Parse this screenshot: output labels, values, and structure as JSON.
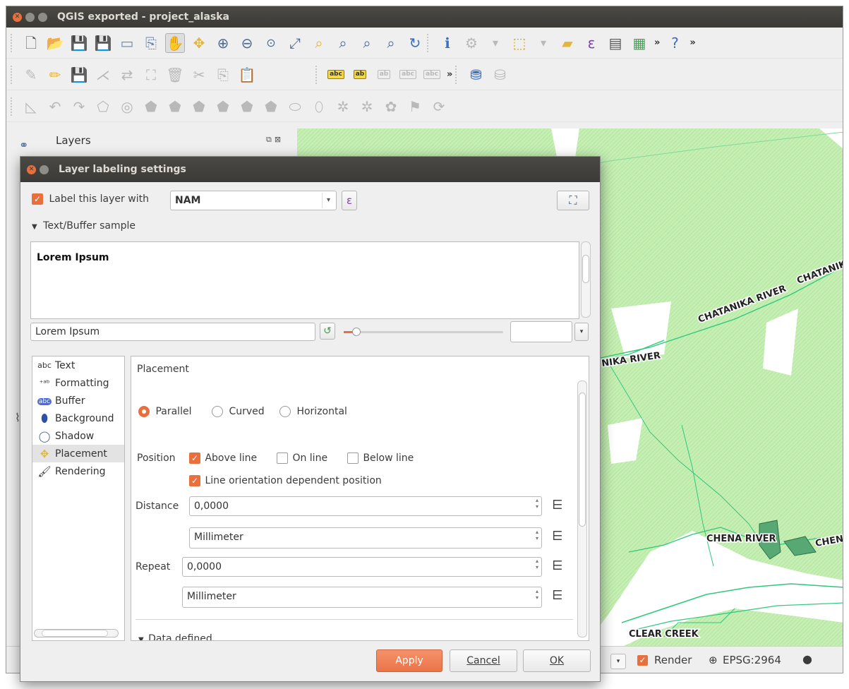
{
  "window": {
    "title": "QGIS exported - project_alaska"
  },
  "toolbar_overflow": "»",
  "layers_panel": {
    "title": "Layers"
  },
  "map_labels": {
    "chatanika_1": "CHATANIKA RIVER",
    "chatanika_2": "CHATANIKA RIVER",
    "chatanika_3": "NIKA RIVER",
    "chatanika_4": "CHATANIKA",
    "chena_1": "CHENA RIVER",
    "chena_2": "CHENA",
    "clear_creek": "CLEAR CREEK"
  },
  "statusbar": {
    "render_label": "Render",
    "render_checked": true,
    "crs": "EPSG:2964"
  },
  "dialog": {
    "title": "Layer labeling settings",
    "label_with": {
      "checkbox_label": "Label this layer with",
      "checked": true,
      "field_value": "NAM"
    },
    "sample_section": "Text/Buffer sample",
    "sample_preview": "Lorem Ipsum",
    "sample_input": "Lorem Ipsum",
    "sidebar": [
      {
        "label": "Text",
        "icon": "text-abc-icon"
      },
      {
        "label": "Formatting",
        "icon": "formatting-icon"
      },
      {
        "label": "Buffer",
        "icon": "buffer-icon"
      },
      {
        "label": "Background",
        "icon": "background-icon"
      },
      {
        "label": "Shadow",
        "icon": "shadow-icon"
      },
      {
        "label": "Placement",
        "icon": "placement-icon",
        "selected": true
      },
      {
        "label": "Rendering",
        "icon": "rendering-icon"
      }
    ],
    "placement": {
      "heading": "Placement",
      "modes": [
        {
          "label": "Parallel",
          "selected": true
        },
        {
          "label": "Curved",
          "selected": false
        },
        {
          "label": "Horizontal",
          "selected": false
        }
      ],
      "position_label": "Position",
      "position_options": [
        {
          "label": "Above line",
          "checked": true
        },
        {
          "label": "On line",
          "checked": false
        },
        {
          "label": "Below line",
          "checked": false
        }
      ],
      "orientation_label": "Line orientation dependent position",
      "orientation_checked": true,
      "distance_label": "Distance",
      "distance_value": "0,0000",
      "distance_unit": "Millimeter",
      "repeat_label": "Repeat",
      "repeat_value": "0,0000",
      "repeat_unit": "Millimeter",
      "data_defined": "Data defined"
    },
    "buttons": {
      "apply": "Apply",
      "cancel": "Cancel",
      "ok": "OK"
    }
  },
  "colors": {
    "accent": "#e9703c",
    "titlebar": "#3c3b37",
    "map_green": "#30c77d",
    "map_fill": "#c8f2b6"
  }
}
